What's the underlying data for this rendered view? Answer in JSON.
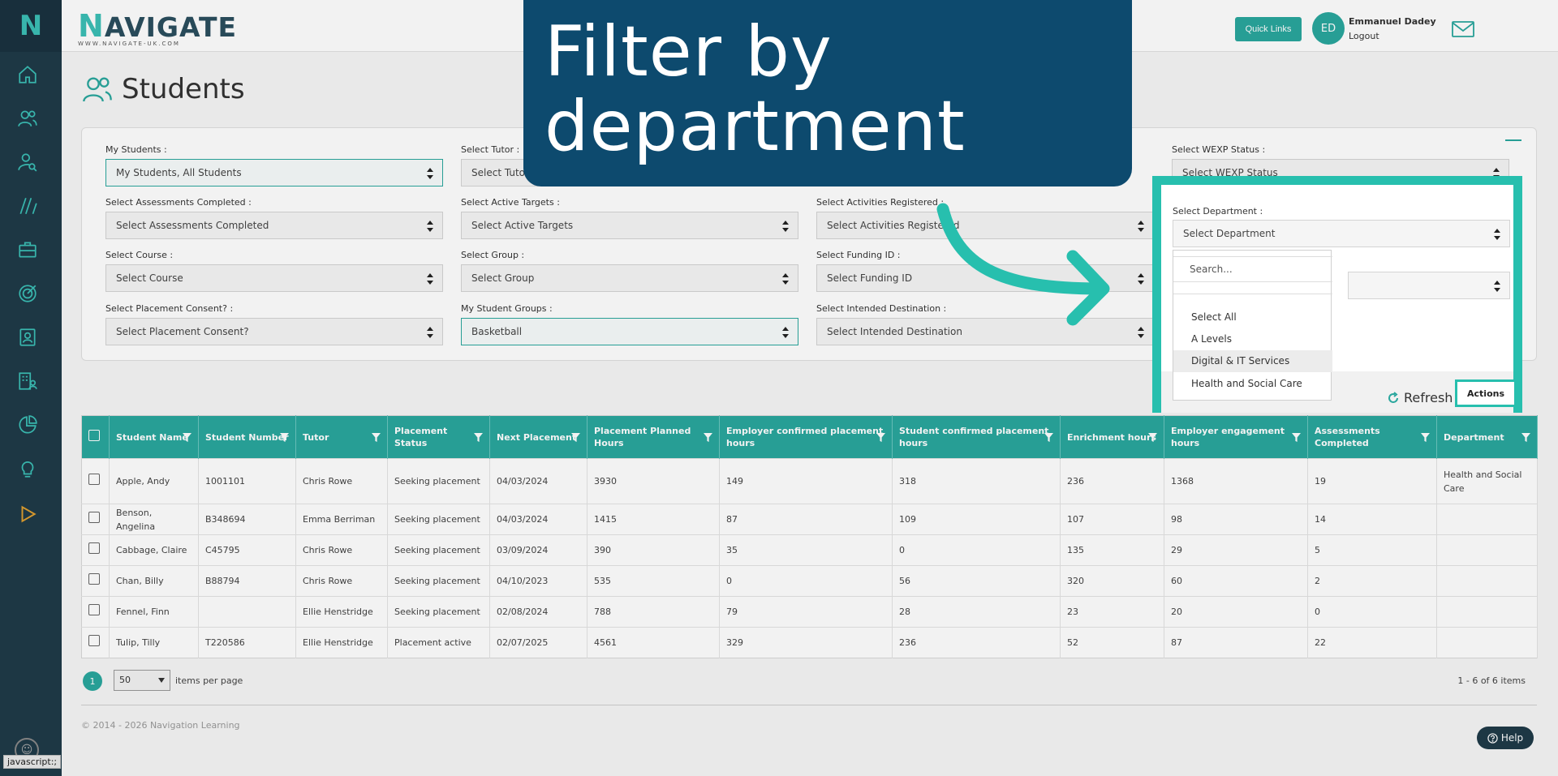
{
  "brand": {
    "name_rest": "AVIGATE",
    "name_initial": "N",
    "url": "WWW.NAVIGATE-UK.COM",
    "sidebar_initial": "N"
  },
  "header": {
    "quick_links": "Quick Links",
    "avatar_initials": "ED",
    "user_name": "Emmanuel Dadey",
    "logout": "Logout"
  },
  "page": {
    "title": "Students"
  },
  "callout": {
    "line1": "Filter by",
    "line2": "department"
  },
  "filters": {
    "my_students": {
      "label": "My Students :",
      "value": "My Students, All Students"
    },
    "tutor": {
      "label": "Select Tutor :",
      "value": "Select Tutor"
    },
    "wexp": {
      "label": "Select WEXP Status :",
      "value": "Select WEXP Status"
    },
    "assessments": {
      "label": "Select Assessments Completed :",
      "value": "Select Assessments Completed"
    },
    "targets": {
      "label": "Select Active Targets :",
      "value": "Select Active Targets"
    },
    "activities": {
      "label": "Select Activities Registered :",
      "value": "Select Activities Registered"
    },
    "course": {
      "label": "Select Course :",
      "value": "Select Course"
    },
    "group": {
      "label": "Select Group :",
      "value": "Select Group"
    },
    "funding": {
      "label": "Select Funding ID :",
      "value": "Select Funding ID"
    },
    "consent": {
      "label": "Select Placement Consent? :",
      "value": "Select Placement Consent?"
    },
    "student_groups": {
      "label": "My Student Groups :",
      "value": "Basketball"
    },
    "destination": {
      "label": "Select Intended Destination :",
      "value": "Select Intended Destination"
    },
    "department": {
      "label": "Select Department :",
      "value": "Select Department"
    }
  },
  "department_dropdown": {
    "search_placeholder": "Search...",
    "options": [
      "Select All",
      "A Levels",
      "Digital & IT Services",
      "Health and Social Care"
    ]
  },
  "panel_buttons": {
    "refresh": "Refresh",
    "actions": "Actions"
  },
  "grid": {
    "columns": [
      "Student Name",
      "Student Number",
      "Tutor",
      "Placement Status",
      "Next Placement",
      "Placement Planned Hours",
      "Employer confirmed placement hours",
      "Student confirmed placement hours",
      "Enrichment hours",
      "Employer engagement hours",
      "Assessments Completed",
      "Department"
    ],
    "rows": [
      [
        "Apple, Andy",
        "1001101",
        "Chris Rowe",
        "Seeking placement",
        "04/03/2024",
        "3930",
        "149",
        "318",
        "236",
        "1368",
        "19",
        "Health and Social Care"
      ],
      [
        "Benson, Angelina",
        "B348694",
        "Emma Berriman",
        "Seeking placement",
        "04/03/2024",
        "1415",
        "87",
        "109",
        "107",
        "98",
        "14",
        ""
      ],
      [
        "Cabbage, Claire",
        "C45795",
        "Chris Rowe",
        "Seeking placement",
        "03/09/2024",
        "390",
        "35",
        "0",
        "135",
        "29",
        "5",
        ""
      ],
      [
        "Chan, Billy",
        "B88794",
        "Chris Rowe",
        "Seeking placement",
        "04/10/2023",
        "535",
        "0",
        "56",
        "320",
        "60",
        "2",
        ""
      ],
      [
        "Fennel, Finn",
        "",
        "Ellie Henstridge",
        "Seeking placement",
        "02/08/2024",
        "788",
        "79",
        "28",
        "23",
        "20",
        "0",
        ""
      ],
      [
        "Tulip, Tilly",
        "T220586",
        "Ellie Henstridge",
        "Placement active",
        "02/07/2025",
        "4561",
        "329",
        "236",
        "52",
        "87",
        "22",
        ""
      ]
    ]
  },
  "pager": {
    "page": "1",
    "page_size": "50",
    "per_page_label": "items per page",
    "info": "1 - 6 of 6 items"
  },
  "footer": {
    "copyright": "© 2014 - 2026 Navigation Learning",
    "help": "Help",
    "status_text": "javascript:;"
  },
  "colors": {
    "teal": "#2aa79e",
    "sidebar": "#1f3a48",
    "callout": "#0d4a6e",
    "highlight": "#27bfae"
  }
}
